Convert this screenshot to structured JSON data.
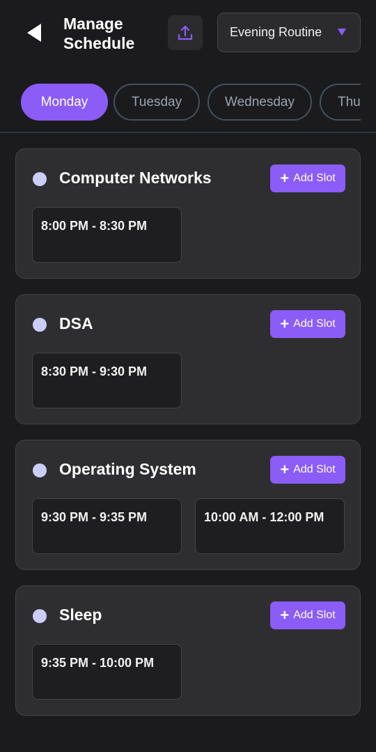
{
  "header": {
    "title": "Manage Schedule",
    "routine": "Evening Routine",
    "icons": {
      "back": "back-arrow-icon",
      "upload": "upload-icon",
      "caret": "chevron-down-icon"
    }
  },
  "tabs": [
    {
      "label": "Monday",
      "active": true
    },
    {
      "label": "Tuesday",
      "active": false
    },
    {
      "label": "Wednesday",
      "active": false
    },
    {
      "label": "Thu",
      "active": false
    }
  ],
  "colors": {
    "accent": "#8b5cf6",
    "background": "#1b1b1d",
    "card": "#2e2e30",
    "dot": "#c9cdf7",
    "tab_inactive_text": "#9aa3b2"
  },
  "add_slot_label": "Add Slot",
  "subjects": [
    {
      "name": "Computer Networks",
      "slots": [
        "8:00 PM - 8:30 PM"
      ]
    },
    {
      "name": "DSA",
      "slots": [
        "8:30 PM - 9:30 PM"
      ]
    },
    {
      "name": "Operating System",
      "slots": [
        "9:30 PM - 9:35 PM",
        "10:00 AM - 12:00 PM"
      ]
    },
    {
      "name": "Sleep",
      "slots": [
        "9:35 PM - 10:00 PM"
      ]
    }
  ]
}
